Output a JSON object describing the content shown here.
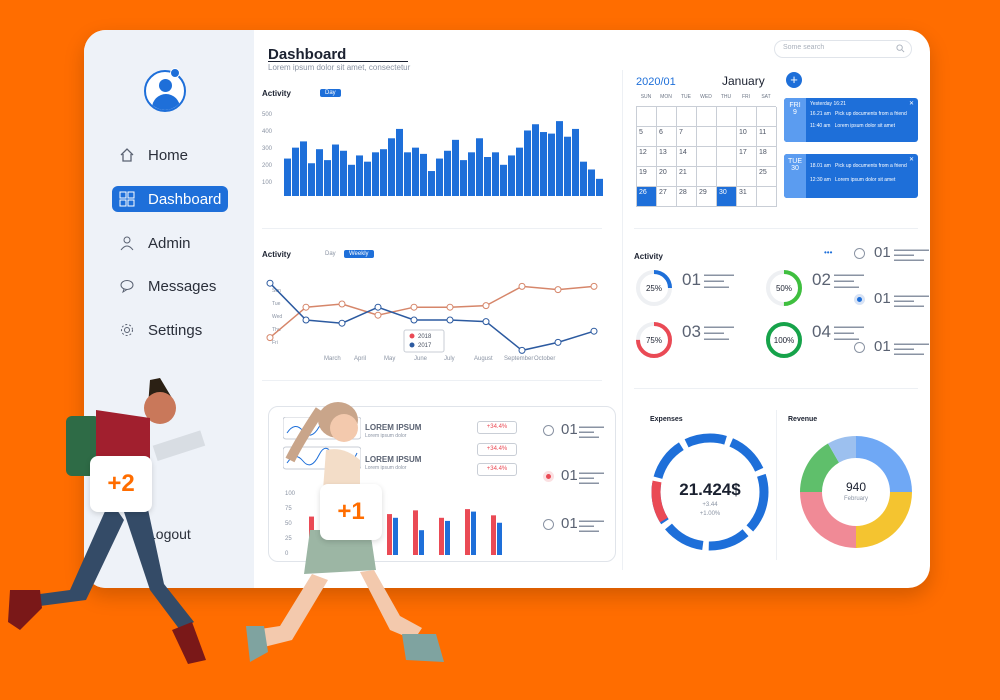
{
  "sidebar": {
    "nav": [
      {
        "label": "Home",
        "icon": "home-icon"
      },
      {
        "label": "Dashboard",
        "icon": "grid-icon"
      },
      {
        "label": "Admin",
        "icon": "user-icon"
      },
      {
        "label": "Messages",
        "icon": "chat-icon"
      },
      {
        "label": "Settings",
        "icon": "gear-icon"
      }
    ],
    "logout": "Logout"
  },
  "header": {
    "title": "Dashboard",
    "subtitle": "Lorem ipsum dolor sit amet, consectetur",
    "search_placeholder": "Some search"
  },
  "activity_bar": {
    "title": "Activity",
    "tab_active": "Day",
    "y_ticks": [
      "500",
      "400",
      "300",
      "200",
      "100"
    ]
  },
  "activity_line": {
    "title": "Activity",
    "tabs": [
      "Day",
      "Weekly"
    ],
    "x_ticks": [
      "March",
      "April",
      "May",
      "June",
      "July",
      "August",
      "September",
      "October"
    ],
    "y_ticks": [
      "Sun",
      "Tue",
      "Wed",
      "Thu",
      "Fri"
    ],
    "legend": [
      "2018",
      "2017"
    ]
  },
  "calendar": {
    "year_month": "2020/01",
    "month": "January",
    "add_label": "+",
    "weekdays": [
      "SUN",
      "MON",
      "TUE",
      "WED",
      "THU",
      "FRI",
      "SAT"
    ],
    "cells": [
      "",
      "",
      "",
      "",
      "",
      "",
      "",
      "5",
      "6",
      "7",
      "",
      "",
      "10",
      "11",
      "12",
      "13",
      "14",
      "",
      "",
      "17",
      "18",
      "19",
      "20",
      "21",
      "",
      "",
      "",
      "25",
      "26",
      "27",
      "28",
      "29",
      "30",
      "31",
      ""
    ],
    "events": [
      {
        "day": "FRI",
        "date": "9",
        "head": "Yesterday 16:21",
        "time1": "16.21 am",
        "text1": "Pick up documents from a friend",
        "time2": "11:40 am",
        "text2": "Lorem ipsum dolor sit amet"
      },
      {
        "day": "TUE",
        "date": "30",
        "head": "",
        "time1": "18.01 am",
        "text1": "Pick up documents from a friend",
        "time2": "12:30 am",
        "text2": "Lorem ipsum dolor sit amet"
      }
    ]
  },
  "activity_rings": {
    "title": "Activity",
    "more": "•••",
    "items": [
      {
        "pct": "25%",
        "num": "01",
        "color": "#1e6fd9",
        "value": 0.25
      },
      {
        "pct": "50%",
        "num": "02",
        "color": "#3fbf3f",
        "value": 0.5
      },
      {
        "pct": "75%",
        "num": "03",
        "color": "#ea4a55",
        "value": 0.75
      },
      {
        "pct": "100%",
        "num": "04",
        "color": "#16a34a",
        "value": 1.0
      }
    ],
    "list": [
      "01",
      "01",
      "01"
    ]
  },
  "lorem_card": {
    "items": [
      {
        "title": "LOREM IPSUM",
        "sub": "Lorem ipsum dolor",
        "pct": "+34.4%"
      },
      {
        "title": "LOREM IPSUM",
        "sub": "Lorem ipsum dolor",
        "pct": "+34.4%"
      }
    ],
    "extra_pct": "+34.4%",
    "y_ticks": [
      "100",
      "75",
      "50",
      "25",
      "0"
    ],
    "list": [
      "01",
      "01",
      "01"
    ]
  },
  "expenses": {
    "title": "Expenses",
    "value": "21.424$",
    "sub1": "+3.44",
    "sub2": "+1.00%"
  },
  "revenue": {
    "title": "Revenue",
    "value": "940",
    "sub": "February"
  },
  "badges": [
    "+2",
    "+1"
  ],
  "colors": {
    "accent": "#1e6fd9",
    "background": "#ff6d00",
    "red": "#ea4a55"
  }
}
